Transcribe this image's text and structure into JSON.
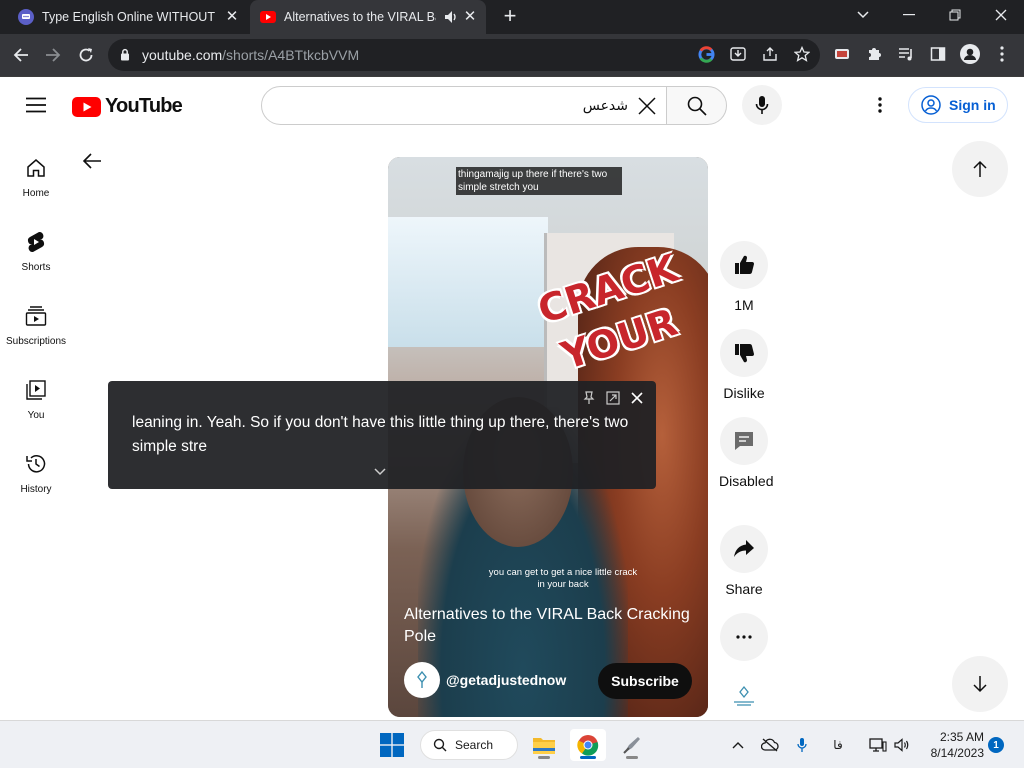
{
  "browser": {
    "tabs": [
      {
        "title": "Type English Online WITHOUT an"
      },
      {
        "title": "Alternatives to the VIRAL Back"
      }
    ],
    "url_host": "youtube.com",
    "url_path": "/shorts/A4BTtkcbVVM"
  },
  "youtube": {
    "logo_text": "YouTube",
    "search_query": "شدعس",
    "sign_in": "Sign in",
    "guide": [
      {
        "label": "Home",
        "icon": "home-icon"
      },
      {
        "label": "Shorts",
        "icon": "shorts-icon"
      },
      {
        "label": "Subscriptions",
        "icon": "subscriptions-icon"
      },
      {
        "label": "You",
        "icon": "you-icon"
      },
      {
        "label": "History",
        "icon": "history-icon"
      }
    ]
  },
  "short": {
    "top_caption": "thingamajig up there if there's two simple stretch you",
    "overlay_word_1": "CRACK",
    "overlay_word_2": "YOUR",
    "shirt_caption": "you can get to get a nice little crack in your back",
    "title": "Alternatives to the VIRAL Back Cracking Pole",
    "channel": "@getadjustednow",
    "subscribe": "Subscribe",
    "likes": "1M",
    "dislike": "Dislike",
    "comments": "Disabled",
    "share": "Share"
  },
  "live_caption": {
    "text": "leaning in. Yeah. So if you don't have this little thing up there, there's two simple stre"
  },
  "taskbar": {
    "search": "Search",
    "language": "فا",
    "time": "2:35 AM",
    "date": "8/14/2023",
    "notifications": "1"
  }
}
